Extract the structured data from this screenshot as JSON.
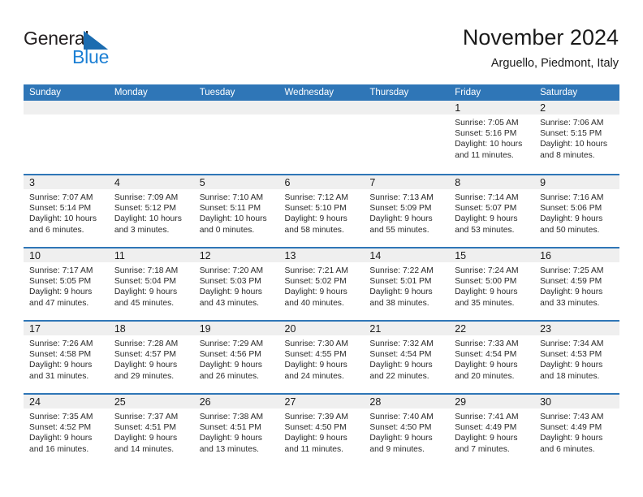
{
  "brand": {
    "word_one": "General",
    "word_two": "Blue",
    "triangle_icon": "blue-triangle-icon",
    "color_dark": "#231f20",
    "color_blue": "#1b7fd4"
  },
  "header": {
    "title": "November 2024",
    "subtitle": "Arguello, Piedmont, Italy"
  },
  "theme": {
    "header_blue": "#2f76b7",
    "daynum_strip": "#efefef",
    "text": "#1a1a1a"
  },
  "weekdays": [
    "Sunday",
    "Monday",
    "Tuesday",
    "Wednesday",
    "Thursday",
    "Friday",
    "Saturday"
  ],
  "weeks": [
    [
      {
        "day": "",
        "lines": []
      },
      {
        "day": "",
        "lines": []
      },
      {
        "day": "",
        "lines": []
      },
      {
        "day": "",
        "lines": []
      },
      {
        "day": "",
        "lines": []
      },
      {
        "day": "1",
        "lines": [
          "Sunrise: 7:05 AM",
          "Sunset: 5:16 PM",
          "Daylight: 10 hours",
          "and 11 minutes."
        ]
      },
      {
        "day": "2",
        "lines": [
          "Sunrise: 7:06 AM",
          "Sunset: 5:15 PM",
          "Daylight: 10 hours",
          "and 8 minutes."
        ]
      }
    ],
    [
      {
        "day": "3",
        "lines": [
          "Sunrise: 7:07 AM",
          "Sunset: 5:14 PM",
          "Daylight: 10 hours",
          "and 6 minutes."
        ]
      },
      {
        "day": "4",
        "lines": [
          "Sunrise: 7:09 AM",
          "Sunset: 5:12 PM",
          "Daylight: 10 hours",
          "and 3 minutes."
        ]
      },
      {
        "day": "5",
        "lines": [
          "Sunrise: 7:10 AM",
          "Sunset: 5:11 PM",
          "Daylight: 10 hours",
          "and 0 minutes."
        ]
      },
      {
        "day": "6",
        "lines": [
          "Sunrise: 7:12 AM",
          "Sunset: 5:10 PM",
          "Daylight: 9 hours",
          "and 58 minutes."
        ]
      },
      {
        "day": "7",
        "lines": [
          "Sunrise: 7:13 AM",
          "Sunset: 5:09 PM",
          "Daylight: 9 hours",
          "and 55 minutes."
        ]
      },
      {
        "day": "8",
        "lines": [
          "Sunrise: 7:14 AM",
          "Sunset: 5:07 PM",
          "Daylight: 9 hours",
          "and 53 minutes."
        ]
      },
      {
        "day": "9",
        "lines": [
          "Sunrise: 7:16 AM",
          "Sunset: 5:06 PM",
          "Daylight: 9 hours",
          "and 50 minutes."
        ]
      }
    ],
    [
      {
        "day": "10",
        "lines": [
          "Sunrise: 7:17 AM",
          "Sunset: 5:05 PM",
          "Daylight: 9 hours",
          "and 47 minutes."
        ]
      },
      {
        "day": "11",
        "lines": [
          "Sunrise: 7:18 AM",
          "Sunset: 5:04 PM",
          "Daylight: 9 hours",
          "and 45 minutes."
        ]
      },
      {
        "day": "12",
        "lines": [
          "Sunrise: 7:20 AM",
          "Sunset: 5:03 PM",
          "Daylight: 9 hours",
          "and 43 minutes."
        ]
      },
      {
        "day": "13",
        "lines": [
          "Sunrise: 7:21 AM",
          "Sunset: 5:02 PM",
          "Daylight: 9 hours",
          "and 40 minutes."
        ]
      },
      {
        "day": "14",
        "lines": [
          "Sunrise: 7:22 AM",
          "Sunset: 5:01 PM",
          "Daylight: 9 hours",
          "and 38 minutes."
        ]
      },
      {
        "day": "15",
        "lines": [
          "Sunrise: 7:24 AM",
          "Sunset: 5:00 PM",
          "Daylight: 9 hours",
          "and 35 minutes."
        ]
      },
      {
        "day": "16",
        "lines": [
          "Sunrise: 7:25 AM",
          "Sunset: 4:59 PM",
          "Daylight: 9 hours",
          "and 33 minutes."
        ]
      }
    ],
    [
      {
        "day": "17",
        "lines": [
          "Sunrise: 7:26 AM",
          "Sunset: 4:58 PM",
          "Daylight: 9 hours",
          "and 31 minutes."
        ]
      },
      {
        "day": "18",
        "lines": [
          "Sunrise: 7:28 AM",
          "Sunset: 4:57 PM",
          "Daylight: 9 hours",
          "and 29 minutes."
        ]
      },
      {
        "day": "19",
        "lines": [
          "Sunrise: 7:29 AM",
          "Sunset: 4:56 PM",
          "Daylight: 9 hours",
          "and 26 minutes."
        ]
      },
      {
        "day": "20",
        "lines": [
          "Sunrise: 7:30 AM",
          "Sunset: 4:55 PM",
          "Daylight: 9 hours",
          "and 24 minutes."
        ]
      },
      {
        "day": "21",
        "lines": [
          "Sunrise: 7:32 AM",
          "Sunset: 4:54 PM",
          "Daylight: 9 hours",
          "and 22 minutes."
        ]
      },
      {
        "day": "22",
        "lines": [
          "Sunrise: 7:33 AM",
          "Sunset: 4:54 PM",
          "Daylight: 9 hours",
          "and 20 minutes."
        ]
      },
      {
        "day": "23",
        "lines": [
          "Sunrise: 7:34 AM",
          "Sunset: 4:53 PM",
          "Daylight: 9 hours",
          "and 18 minutes."
        ]
      }
    ],
    [
      {
        "day": "24",
        "lines": [
          "Sunrise: 7:35 AM",
          "Sunset: 4:52 PM",
          "Daylight: 9 hours",
          "and 16 minutes."
        ]
      },
      {
        "day": "25",
        "lines": [
          "Sunrise: 7:37 AM",
          "Sunset: 4:51 PM",
          "Daylight: 9 hours",
          "and 14 minutes."
        ]
      },
      {
        "day": "26",
        "lines": [
          "Sunrise: 7:38 AM",
          "Sunset: 4:51 PM",
          "Daylight: 9 hours",
          "and 13 minutes."
        ]
      },
      {
        "day": "27",
        "lines": [
          "Sunrise: 7:39 AM",
          "Sunset: 4:50 PM",
          "Daylight: 9 hours",
          "and 11 minutes."
        ]
      },
      {
        "day": "28",
        "lines": [
          "Sunrise: 7:40 AM",
          "Sunset: 4:50 PM",
          "Daylight: 9 hours",
          "and 9 minutes."
        ]
      },
      {
        "day": "29",
        "lines": [
          "Sunrise: 7:41 AM",
          "Sunset: 4:49 PM",
          "Daylight: 9 hours",
          "and 7 minutes."
        ]
      },
      {
        "day": "30",
        "lines": [
          "Sunrise: 7:43 AM",
          "Sunset: 4:49 PM",
          "Daylight: 9 hours",
          "and 6 minutes."
        ]
      }
    ]
  ]
}
